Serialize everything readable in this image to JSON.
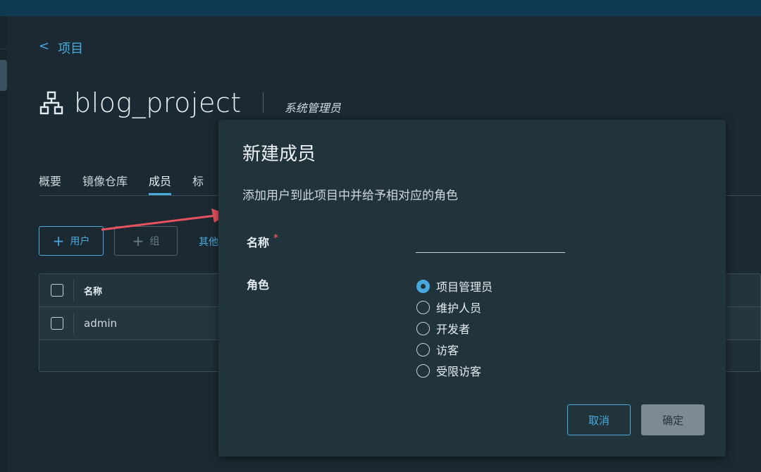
{
  "nav": {
    "back_label": "项目",
    "back_chevron": "<"
  },
  "project": {
    "name": "blog_project",
    "role": "系统管理员",
    "icon": "project-icon"
  },
  "tabs": [
    {
      "label": "概要"
    },
    {
      "label": "镜像仓库"
    },
    {
      "label": "成员",
      "active": true
    },
    {
      "label": "标"
    }
  ],
  "toolbar": {
    "add_user_label": "用户",
    "add_group_label": "组",
    "other_label": "其他"
  },
  "grid": {
    "header": {
      "name_col": "名称"
    },
    "rows": [
      {
        "name": "admin"
      }
    ]
  },
  "modal": {
    "title": "新建成员",
    "description": "添加用户到此项目中并给予相对应的角色",
    "name_label": "名称",
    "required_mark": "*",
    "name_value": "",
    "role_label": "角色",
    "roles": [
      {
        "label": "项目管理员",
        "checked": true
      },
      {
        "label": "维护人员",
        "checked": false
      },
      {
        "label": "开发者",
        "checked": false
      },
      {
        "label": "访客",
        "checked": false
      },
      {
        "label": "受限访客",
        "checked": false
      }
    ],
    "cancel_label": "取消",
    "ok_label": "确定"
  },
  "colors": {
    "accent": "#49a9dd",
    "background": "#1b2a32",
    "modal_bg": "#21333b",
    "annotation_arrow": "#e8525f"
  }
}
